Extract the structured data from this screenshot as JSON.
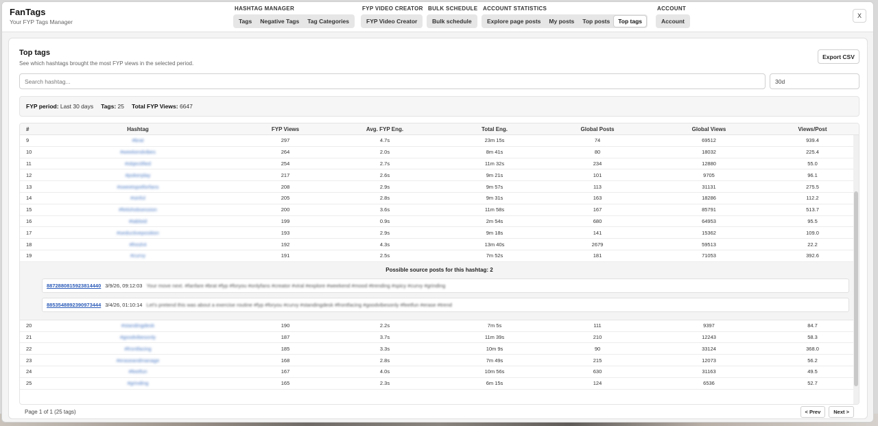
{
  "app": {
    "title": "FanTags",
    "subtitle": "Your FYP Tags Manager"
  },
  "nav": [
    {
      "title": "HASHTAG MANAGER",
      "x": 0,
      "items": [
        "Tags",
        "Negative Tags",
        "Tag Categories"
      ]
    },
    {
      "title": "FYP VIDEO CREATOR",
      "items": [
        "FYP Video Creator"
      ]
    },
    {
      "title": "BULK SCHEDULE",
      "items": [
        "Bulk schedule"
      ]
    },
    {
      "title": "ACCOUNT STATISTICS",
      "items": [
        "Explore page posts",
        "My posts",
        "Top posts",
        "Top tags"
      ]
    },
    {
      "title": "ACCOUNT",
      "items": [
        "Account"
      ]
    }
  ],
  "active_nav": "Top tags",
  "close_label": "X",
  "page": {
    "title": "Top tags",
    "subtitle": "See which hashtags brought the most FYP views in the selected period.",
    "export_label": "Export CSV",
    "search_placeholder": "Search hashtag...",
    "period_value": "30d"
  },
  "summary": {
    "period_label": "FYP period:",
    "period_value": "Last 30 days",
    "tags_label": "Tags:",
    "tags_value": "25",
    "views_label": "Total FYP Views:",
    "views_value": "6647"
  },
  "table": {
    "columns": [
      "#",
      "Hashtag",
      "FYP Views",
      "Avg. FYP Eng.",
      "Total Eng.",
      "Global Posts",
      "Global Views",
      "Views/Post"
    ],
    "rows_before": [
      [
        "9",
        "#brat",
        "297",
        "4.7s",
        "23m 15s",
        "74",
        "69512",
        "939.4"
      ],
      [
        "10",
        "#weekendvibes",
        "264",
        "2.0s",
        "8m 41s",
        "80",
        "18032",
        "225.4"
      ],
      [
        "11",
        "#objectified",
        "254",
        "2.7s",
        "11m 32s",
        "234",
        "12880",
        "55.0"
      ],
      [
        "12",
        "#pokerplay",
        "217",
        "2.6s",
        "9m 21s",
        "101",
        "9705",
        "96.1"
      ],
      [
        "13",
        "#sweetspotforfans",
        "208",
        "2.9s",
        "9m 57s",
        "113",
        "31131",
        "275.5"
      ],
      [
        "14",
        "#sinful",
        "205",
        "2.8s",
        "9m 31s",
        "163",
        "18286",
        "112.2"
      ],
      [
        "15",
        "#fetishobsession",
        "200",
        "3.6s",
        "11m 58s",
        "167",
        "85791",
        "513.7"
      ],
      [
        "16",
        "#tabloid",
        "199",
        "0.9s",
        "2m 54s",
        "680",
        "64953",
        "95.5"
      ],
      [
        "17",
        "#seductiveposition",
        "193",
        "2.9s",
        "9m 18s",
        "141",
        "15362",
        "109.0"
      ],
      [
        "18",
        "#fresh4",
        "192",
        "4.3s",
        "13m 40s",
        "2679",
        "59513",
        "22.2"
      ],
      [
        "19",
        "#curvy",
        "191",
        "2.5s",
        "7m 52s",
        "181",
        "71053",
        "392.6"
      ]
    ],
    "rows_after": [
      [
        "20",
        "#standingdesk",
        "190",
        "2.2s",
        "7m 5s",
        "111",
        "9397",
        "84.7"
      ],
      [
        "21",
        "#goodvibesonly",
        "187",
        "3.7s",
        "11m 39s",
        "210",
        "12243",
        "58.3"
      ],
      [
        "22",
        "#frontfacing",
        "185",
        "3.3s",
        "10m 9s",
        "90",
        "33124",
        "368.0"
      ],
      [
        "23",
        "#eraseandmanage",
        "168",
        "2.8s",
        "7m 49s",
        "215",
        "12073",
        "56.2"
      ],
      [
        "24",
        "#feetfun",
        "167",
        "4.0s",
        "10m 56s",
        "630",
        "31163",
        "49.5"
      ],
      [
        "25",
        "#grinding",
        "165",
        "2.3s",
        "6m 15s",
        "124",
        "6536",
        "52.7"
      ]
    ]
  },
  "expand": {
    "title": "Possible source posts for this hashtag: 2",
    "posts": [
      {
        "id": "8872880815923814440",
        "date": "3/9/26, 09:12:03",
        "caption": "Your move next. #fanfare #brat #fyp #foryou #onlyfans #creator #viral #explore #weekend #mood #trending #spicy #curvy #grinding"
      },
      {
        "id": "8853548892390973444",
        "date": "3/4/26, 01:10:14",
        "caption": "Let's pretend this was about a exercise routine #fyp #foryou #curvy #standingdesk #frontfacing #goodvibesonly #feetfun #erase #trend"
      }
    ]
  },
  "footer": {
    "page_info": "Page 1 of 1 (25 tags)",
    "prev_label": "< Prev",
    "next_label": "Next >"
  }
}
